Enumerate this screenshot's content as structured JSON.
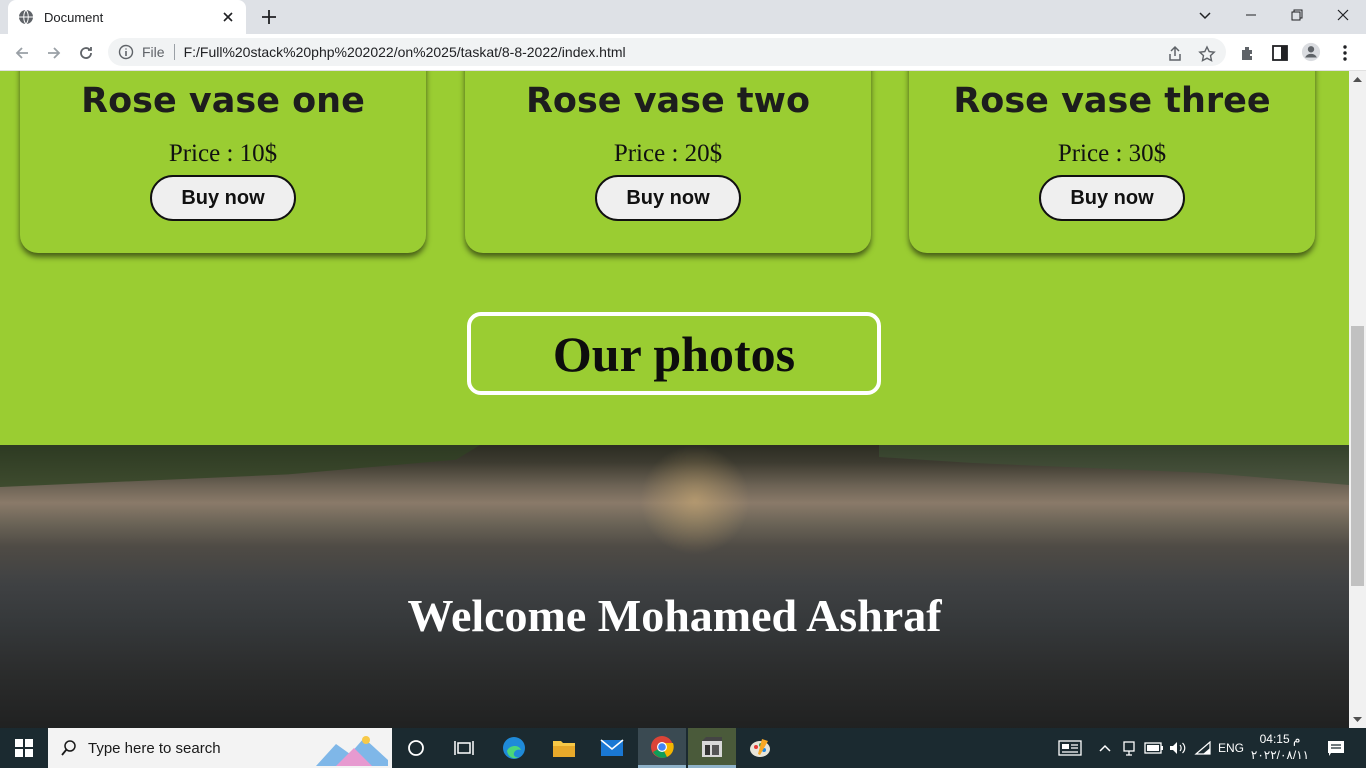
{
  "browser": {
    "tab_title": "Document",
    "omnibox": {
      "scheme_label": "File",
      "url": "F:/Full%20stack%20php%202022/on%2025/taskat/8-8-2022/index.html"
    }
  },
  "page": {
    "products": [
      {
        "name": "Rose vase one",
        "price": "Price : 10$",
        "button": "Buy now"
      },
      {
        "name": "Rose vase two",
        "price": "Price : 20$",
        "button": "Buy now"
      },
      {
        "name": "Rose vase three",
        "price": "Price : 30$",
        "button": "Buy now"
      }
    ],
    "photos_heading": "Our photos",
    "welcome": "Welcome Mohamed Ashraf",
    "colors": {
      "background": "#9acd32",
      "button": "#efefef"
    }
  },
  "taskbar": {
    "search_placeholder": "Type here to search",
    "language": "ENG",
    "time": "04:15 م",
    "date": "٢٠٢٢/٠٨/١١"
  }
}
